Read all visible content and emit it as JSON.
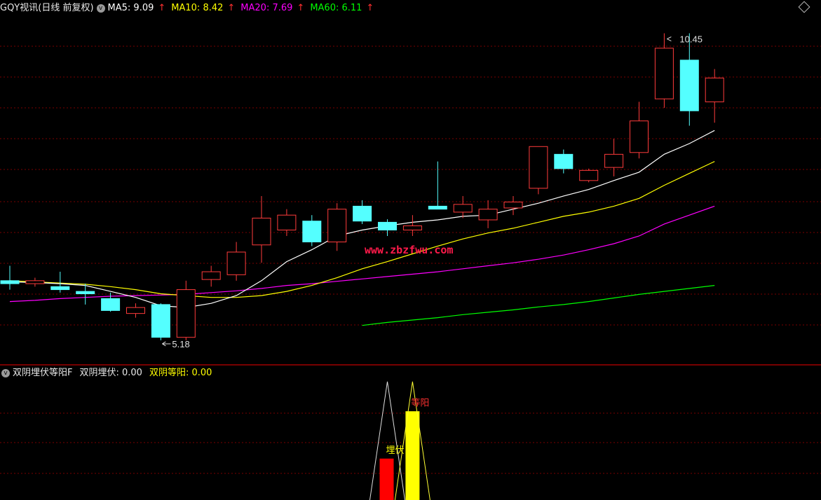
{
  "header": {
    "title": "GQY视讯(日线 前复权)",
    "menu_glyph": "v",
    "ma": [
      {
        "label": "MA5: 9.09",
        "color": "#ffffff"
      },
      {
        "label": "MA10: 8.42",
        "color": "#ffff00"
      },
      {
        "label": "MA20: 7.69",
        "color": "#ff00ff"
      },
      {
        "label": "MA60: 6.11",
        "color": "#00ff00"
      }
    ],
    "arrow": "↑"
  },
  "indicator": {
    "name": "双阴埋伏等阳F",
    "line1": "双阴埋伏: 0.00",
    "line2": "双阴等阳: 0.00",
    "label_ambush": "埋伏",
    "label_wait": "等阳"
  },
  "watermark": "www.zbzfwu.com",
  "colors": {
    "up": "#ff3b3b",
    "down": "#54ffff",
    "grid": "#7a0000",
    "ma5": "#ffffff",
    "ma10": "#ffff00",
    "ma20": "#ff00ff",
    "ma60": "#00ff00"
  },
  "chart_data": {
    "type": "candlestick",
    "price_range": [
      4.9,
      10.75
    ],
    "high_label": "10.45",
    "low_label": "5.18",
    "candles": [
      {
        "o": 6.3,
        "h": 6.55,
        "l": 6.15,
        "c": 6.25
      },
      {
        "o": 6.25,
        "h": 6.35,
        "l": 6.2,
        "c": 6.3
      },
      {
        "o": 6.2,
        "h": 6.45,
        "l": 6.1,
        "c": 6.15
      },
      {
        "o": 6.12,
        "h": 6.25,
        "l": 5.9,
        "c": 6.08
      },
      {
        "o": 6.0,
        "h": 6.1,
        "l": 5.78,
        "c": 5.8
      },
      {
        "o": 5.75,
        "h": 5.92,
        "l": 5.68,
        "c": 5.85
      },
      {
        "o": 5.9,
        "h": 5.92,
        "l": 5.3,
        "c": 5.35
      },
      {
        "o": 5.35,
        "h": 6.3,
        "l": 5.3,
        "c": 6.15
      },
      {
        "o": 6.32,
        "h": 6.55,
        "l": 6.2,
        "c": 6.45
      },
      {
        "o": 6.4,
        "h": 6.95,
        "l": 6.3,
        "c": 6.78
      },
      {
        "o": 6.9,
        "h": 7.72,
        "l": 6.6,
        "c": 7.35
      },
      {
        "o": 7.15,
        "h": 7.5,
        "l": 7.05,
        "c": 7.4
      },
      {
        "o": 7.3,
        "h": 7.4,
        "l": 6.88,
        "c": 6.95
      },
      {
        "o": 6.95,
        "h": 7.6,
        "l": 6.8,
        "c": 7.5
      },
      {
        "o": 7.55,
        "h": 7.65,
        "l": 7.25,
        "c": 7.3
      },
      {
        "o": 7.28,
        "h": 7.33,
        "l": 7.05,
        "c": 7.15
      },
      {
        "o": 7.15,
        "h": 7.4,
        "l": 7.05,
        "c": 7.22
      },
      {
        "o": 7.55,
        "h": 8.3,
        "l": 7.5,
        "c": 7.5
      },
      {
        "o": 7.45,
        "h": 7.72,
        "l": 7.35,
        "c": 7.58
      },
      {
        "o": 7.32,
        "h": 7.65,
        "l": 7.18,
        "c": 7.5
      },
      {
        "o": 7.52,
        "h": 7.72,
        "l": 7.4,
        "c": 7.62
      },
      {
        "o": 7.85,
        "h": 8.4,
        "l": 7.75,
        "c": 8.55
      },
      {
        "o": 8.42,
        "h": 8.5,
        "l": 8.1,
        "c": 8.18
      },
      {
        "o": 7.98,
        "h": 8.18,
        "l": 7.95,
        "c": 8.15
      },
      {
        "o": 8.2,
        "h": 8.68,
        "l": 8.05,
        "c": 8.42
      },
      {
        "o": 8.45,
        "h": 9.3,
        "l": 8.35,
        "c": 8.98
      },
      {
        "o": 9.35,
        "h": 10.45,
        "l": 9.2,
        "c": 10.2
      },
      {
        "o": 10.0,
        "h": 10.45,
        "l": 8.9,
        "c": 9.15
      },
      {
        "o": 9.3,
        "h": 9.85,
        "l": 8.95,
        "c": 9.7
      }
    ],
    "ma5": [
      6.28,
      6.27,
      6.25,
      6.22,
      6.12,
      6.02,
      5.88,
      5.85,
      5.92,
      6.05,
      6.3,
      6.62,
      6.82,
      7.05,
      7.15,
      7.22,
      7.28,
      7.32,
      7.38,
      7.4,
      7.5,
      7.6,
      7.72,
      7.83,
      7.98,
      8.12,
      8.42,
      8.6,
      8.82
    ],
    "ma10": [
      6.3,
      6.28,
      6.26,
      6.24,
      6.2,
      6.15,
      6.08,
      6.05,
      6.02,
      6.02,
      6.05,
      6.12,
      6.22,
      6.35,
      6.5,
      6.62,
      6.75,
      6.88,
      7.0,
      7.1,
      7.18,
      7.28,
      7.38,
      7.45,
      7.55,
      7.68,
      7.9,
      8.1,
      8.3
    ],
    "ma20": [
      5.95,
      5.97,
      6.0,
      6.02,
      6.04,
      6.05,
      6.06,
      6.07,
      6.1,
      6.13,
      6.17,
      6.22,
      6.25,
      6.29,
      6.33,
      6.37,
      6.41,
      6.45,
      6.5,
      6.55,
      6.6,
      6.66,
      6.73,
      6.82,
      6.92,
      7.05,
      7.25,
      7.4,
      7.55
    ],
    "ma60": {
      "start_index": 14,
      "values": [
        5.55,
        5.6,
        5.64,
        5.68,
        5.73,
        5.77,
        5.81,
        5.86,
        5.9,
        5.95,
        6.01,
        6.07,
        6.12,
        6.17,
        6.22
      ]
    },
    "indicator_bars": {
      "ambush": {
        "index": 15,
        "color": "#ff0000",
        "level": 0.35
      },
      "wait": {
        "index": 16,
        "color": "#ffff00",
        "level": 0.75
      }
    }
  }
}
